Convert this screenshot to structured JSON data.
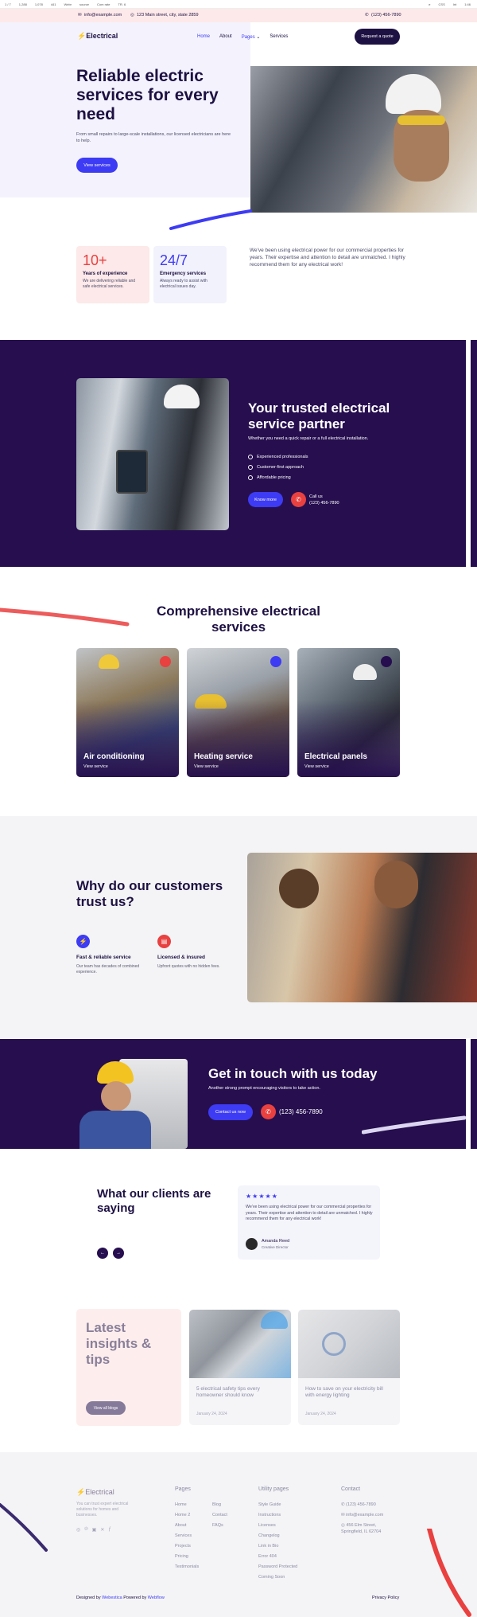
{
  "devbar": {
    "items": [
      "1 / 7",
      "1,288",
      "1,078",
      "441",
      "Webr",
      "source",
      "Com rate",
      "TR. 6",
      "e",
      "CSS",
      "Int",
      "1:46"
    ]
  },
  "topbar": {
    "email": "info@example.com",
    "address": "123 Main street, city, state 2859",
    "phone": "(123) 456-7890"
  },
  "nav": {
    "logo": "Electrical",
    "links": [
      "Home",
      "About",
      "Pages",
      "Services"
    ],
    "cta": "Request a quote"
  },
  "hero": {
    "title": "Reliable electric services for every need",
    "text": "From small repairs to large-scale installations, our licensed electricians are here to help.",
    "button": "View services"
  },
  "stats": [
    {
      "number": "10+",
      "title": "Years of experience",
      "desc": "We are delivering reliable and safe electrical services."
    },
    {
      "number": "24/7",
      "title": "Emergency services",
      "desc": "Always ready to assist with electrical issues day."
    }
  ],
  "testimonial_intro": "We've been using electrical power for our commercial properties for years. Their expertise and attention to detail are unmatched. I highly recommend them for any electrical work!",
  "partner": {
    "title": "Your trusted electrical service partner",
    "subtitle": "Whether you need a quick repair or a full electrical installation.",
    "list": [
      "Experienced professionals",
      "Customer-first approach",
      "Affordable pricing"
    ],
    "button": "Know more",
    "call_label": "Call us",
    "phone": "(123) 456-7890"
  },
  "services": {
    "title": "Comprehensive electrical services",
    "cards": [
      {
        "title": "Air conditioning",
        "link": "View service"
      },
      {
        "title": "Heating service",
        "link": "View service"
      },
      {
        "title": "Electrical panels",
        "link": "View service"
      }
    ]
  },
  "trust": {
    "title": "Why do our customers trust us?",
    "features": [
      {
        "title": "Fast & reliable service",
        "desc": "Our team has decades of combined experience."
      },
      {
        "title": "Licensed & insured",
        "desc": "Upfront quotes with no hidden fees."
      }
    ]
  },
  "contact": {
    "title": "Get in touch with us today",
    "subtitle": "Another strong prompt encouraging visitors to take action.",
    "button": "Contact us now",
    "phone": "(123) 456-7890"
  },
  "clients": {
    "title": "What our clients are saying",
    "stars": "★★★★★",
    "quote": "We've been using electrical power for our commercial properties for years. Their expertise and attention to detail are unmatched. I highly recommend them for any electrical work!",
    "name": "Amanda Reed",
    "role": "Creative Director"
  },
  "insights": {
    "title": "Latest insights & tips",
    "button": "View all blogs",
    "posts": [
      {
        "title": "5 electrical safety tips every homeowner should know",
        "date": "January 24, 2024"
      },
      {
        "title": "How to save on your electricity bill with energy lighting",
        "date": "January 24, 2024"
      }
    ]
  },
  "footer": {
    "logo": "Electrical",
    "tagline": "You can trust expert electrical solutions for homes and businesses.",
    "pages_title": "Pages",
    "pages_col1": [
      "Home",
      "Home 2",
      "About",
      "Services",
      "Projects",
      "Pricing",
      "Testimonials"
    ],
    "pages_col2": [
      "Blog",
      "Contact",
      "FAQs"
    ],
    "utility_title": "Utility pages",
    "utility": [
      "Style Guide",
      "Instructions",
      "Licenses",
      "Changelog",
      "Link in Bio",
      "Error 404",
      "Password Protected",
      "Coming Soon"
    ],
    "contact_title": "Contact",
    "contact_phone": "(123) 456-7890",
    "contact_email": "info@example.com",
    "contact_address": "456 Elm Street, Springfield, IL 62704",
    "credit_prefix": "Designed by",
    "credit_brand": "Webestica",
    "credit_mid": "Powered by",
    "credit_platform": "Webflow",
    "privacy": "Privacy Policy"
  },
  "colors": {
    "navy": "#1d1042",
    "dark": "#260e4f",
    "blue": "#3d3bf3",
    "red": "#e94040",
    "pink": "#fde9e9"
  }
}
